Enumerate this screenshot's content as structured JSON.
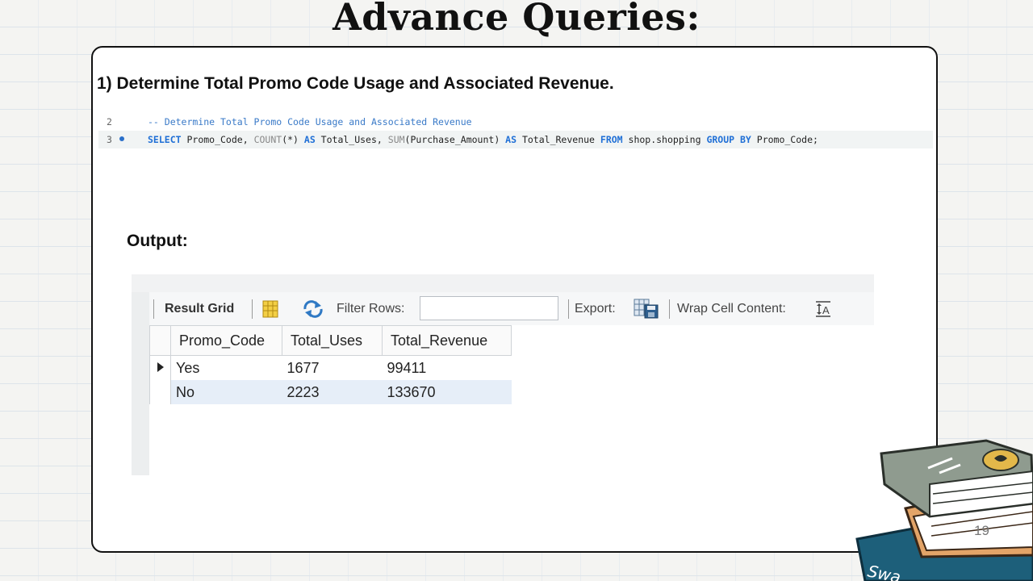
{
  "slide": {
    "title": "Advance Queries:",
    "question": "1) Determine Total Promo Code Usage and Associated Revenue.",
    "output_label": "Output:",
    "page_number": "19",
    "sticker_text": "Swa"
  },
  "editor": {
    "lines": [
      {
        "number": "2",
        "comment": "-- Determine Total Promo Code Usage and Associated Revenue"
      },
      {
        "number": "3",
        "tokens": [
          "SELECT",
          " Promo_Code, ",
          "COUNT",
          "(*) ",
          "AS",
          " Total_Uses, ",
          "SUM",
          "(Purchase_Amount) ",
          "AS",
          " Total_Revenue ",
          "FROM",
          " shop.shopping ",
          "GROUP BY",
          " Promo_Code;"
        ]
      }
    ]
  },
  "toolbar": {
    "result_grid_label": "Result Grid",
    "filter_rows_label": "Filter Rows:",
    "filter_value": "",
    "export_label": "Export:",
    "wrap_label": "Wrap Cell Content:"
  },
  "grid": {
    "columns": [
      "Promo_Code",
      "Total_Uses",
      "Total_Revenue"
    ],
    "rows": [
      [
        "Yes",
        "1677",
        "99411"
      ],
      [
        "No",
        "2223",
        "133670"
      ]
    ]
  },
  "icons": [
    "grid-view-icon",
    "refresh-icon",
    "export-icon",
    "wrap-cell-icon",
    "row-pointer-icon",
    "books-sticker-icon"
  ],
  "colors": {
    "sql_keyword": "#1f6fd6",
    "sql_comment": "#3a7ac8",
    "selected_row": "#e6eef8",
    "sticker_teal": "#1d5f7a"
  }
}
